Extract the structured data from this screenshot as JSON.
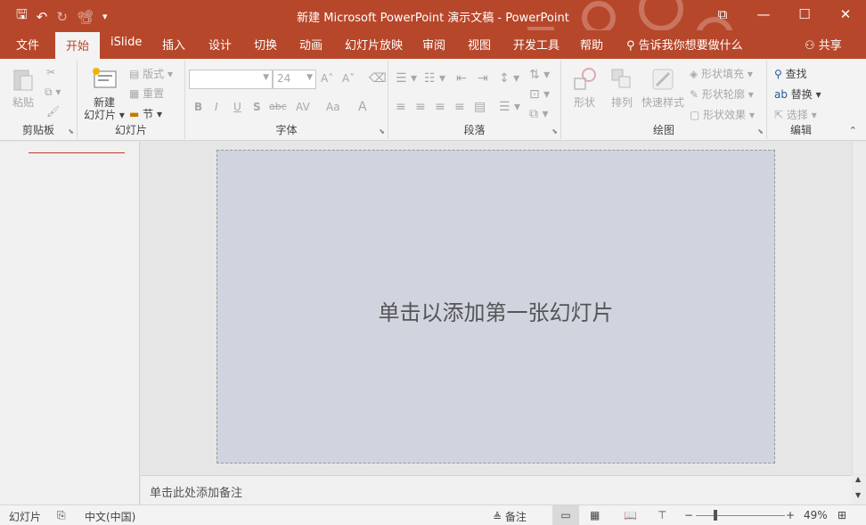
{
  "window": {
    "title": "新建 Microsoft PowerPoint 演示文稿  -  PowerPoint",
    "minimize": "—",
    "maximize": "☐",
    "close": "✕",
    "restore_ribbon": "⧉"
  },
  "qat": {
    "save": "🖫",
    "undo": "↶",
    "redo": "↻",
    "present": "📽",
    "customize": "▾"
  },
  "tabs": [
    "文件",
    "开始",
    "iSlide",
    "插入",
    "设计",
    "切换",
    "动画",
    "幻灯片放映",
    "审阅",
    "视图",
    "开发工具",
    "帮助"
  ],
  "active_tab": "开始",
  "tell_me": "告诉我你想要做什么",
  "share": "共享",
  "ribbon": {
    "clipboard": {
      "label": "剪贴板",
      "paste": "粘贴"
    },
    "slides": {
      "label": "幻灯片",
      "new_slide_line1": "新建",
      "new_slide_line2": "幻灯片 ▾",
      "layout": "版式 ▾",
      "reset": "重置",
      "section": "节 ▾"
    },
    "font": {
      "label": "字体",
      "font_name": "",
      "font_size": "24",
      "bold": "B",
      "italic": "I",
      "underline": "U",
      "shadow": "S",
      "strike": "abc",
      "spacing": "AV",
      "case": "Aa",
      "color": "A",
      "grow": "A˄",
      "shrink": "A˅"
    },
    "paragraph": {
      "label": "段落"
    },
    "drawing": {
      "label": "绘图",
      "shapes": "形状",
      "arrange": "排列",
      "quick_styles": "快速样式",
      "shape_fill": "形状填充 ▾",
      "shape_outline": "形状轮廓 ▾",
      "shape_effects": "形状效果 ▾"
    },
    "editing": {
      "label": "编辑",
      "find": "查找",
      "replace": "替换 ▾",
      "select": "选择 ▾"
    }
  },
  "slide": {
    "placeholder": "单击以添加第一张幻灯片"
  },
  "notes": {
    "placeholder": "单击此处添加备注"
  },
  "status": {
    "slide_label": "幻灯片",
    "language": "中文(中国)",
    "notes": "备注",
    "zoom": "49%"
  },
  "colors": {
    "accent": "#b7472a",
    "slide_bg": "#d0d4de"
  }
}
